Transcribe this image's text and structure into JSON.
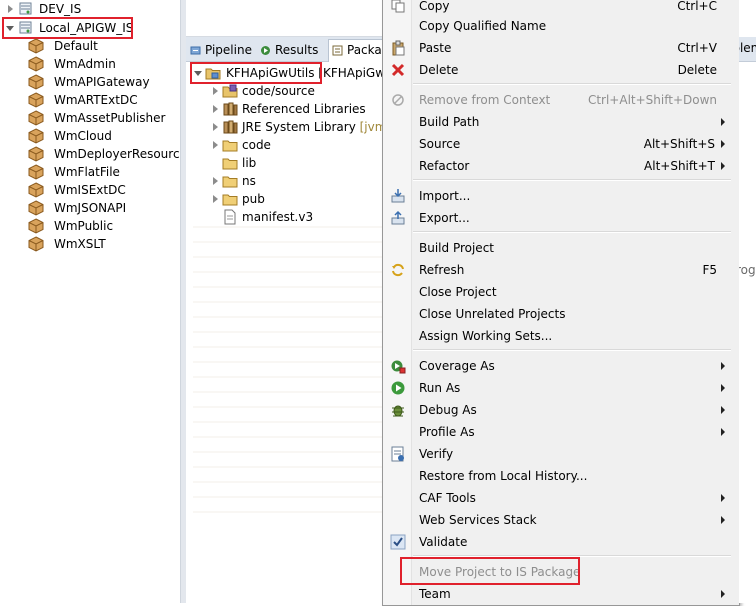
{
  "server_tree": {
    "items": [
      {
        "label": "DEV_IS",
        "expanded": false,
        "type": "server"
      },
      {
        "label": "Local_APIGW_IS",
        "expanded": true,
        "type": "server"
      }
    ],
    "packages": [
      "Default",
      "WmAdmin",
      "WmAPIGateway",
      "WmARTExtDC",
      "WmAssetPublisher",
      "WmCloud",
      "WmDeployerResource",
      "WmFlatFile",
      "WmISExtDC",
      "WmJSONAPI",
      "WmPublic",
      "WmXSLT"
    ]
  },
  "tabs": {
    "pipeline": "Pipeline",
    "results": "Results",
    "package": "Packag"
  },
  "explorer": {
    "project": "KFHApiGwUtils [KFHApiGwUt",
    "items": [
      {
        "label": "code/source",
        "twisty": true,
        "icon": "source-folder"
      },
      {
        "label": "Referenced Libraries",
        "twisty": true,
        "icon": "library"
      },
      {
        "label": "JRE System Library",
        "suffix": "[jvm]",
        "twisty": true,
        "icon": "library"
      },
      {
        "label": "code",
        "twisty": true,
        "icon": "folder"
      },
      {
        "label": "lib",
        "twisty": false,
        "icon": "folder"
      },
      {
        "label": "ns",
        "twisty": true,
        "icon": "folder"
      },
      {
        "label": "pub",
        "twisty": true,
        "icon": "folder"
      },
      {
        "label": "manifest.v3",
        "twisty": false,
        "icon": "file"
      }
    ]
  },
  "context_menu": {
    "copy": {
      "label": "Copy",
      "accel": "Ctrl+C"
    },
    "copy_qualified": {
      "label": "Copy Qualified Name"
    },
    "paste": {
      "label": "Paste",
      "accel": "Ctrl+V"
    },
    "delete": {
      "label": "Delete",
      "accel": "Delete"
    },
    "remove_context": {
      "label": "Remove from Context",
      "accel": "Ctrl+Alt+Shift+Down"
    },
    "build_path": {
      "label": "Build Path"
    },
    "source": {
      "label": "Source",
      "accel": "Alt+Shift+S"
    },
    "refactor": {
      "label": "Refactor",
      "accel": "Alt+Shift+T"
    },
    "import": {
      "label": "Import..."
    },
    "export": {
      "label": "Export..."
    },
    "build_project": {
      "label": "Build Project"
    },
    "refresh": {
      "label": "Refresh",
      "accel": "F5"
    },
    "close_project": {
      "label": "Close Project"
    },
    "close_unrelated": {
      "label": "Close Unrelated Projects"
    },
    "assign_working_sets": {
      "label": "Assign Working Sets..."
    },
    "coverage_as": {
      "label": "Coverage As"
    },
    "run_as": {
      "label": "Run As"
    },
    "debug_as": {
      "label": "Debug As"
    },
    "profile_as": {
      "label": "Profile As"
    },
    "verify": {
      "label": "Verify"
    },
    "restore_history": {
      "label": "Restore from Local History..."
    },
    "caf_tools": {
      "label": "CAF Tools"
    },
    "web_services_stack": {
      "label": "Web Services Stack"
    },
    "validate": {
      "label": "Validate",
      "checked": true
    },
    "move_to_is": {
      "label": "Move Project to IS Package",
      "enabled": false
    },
    "team": {
      "label": "Team"
    }
  },
  "right_edge": {
    "fragment_top": "oblem",
    "fragment_mid": "rogr"
  },
  "colors": {
    "highlight_box": "#e0212c",
    "menu_background": "#f0f0f0",
    "disabled_text": "#8e8e8e",
    "tab_strip": "#dfe6ef"
  }
}
